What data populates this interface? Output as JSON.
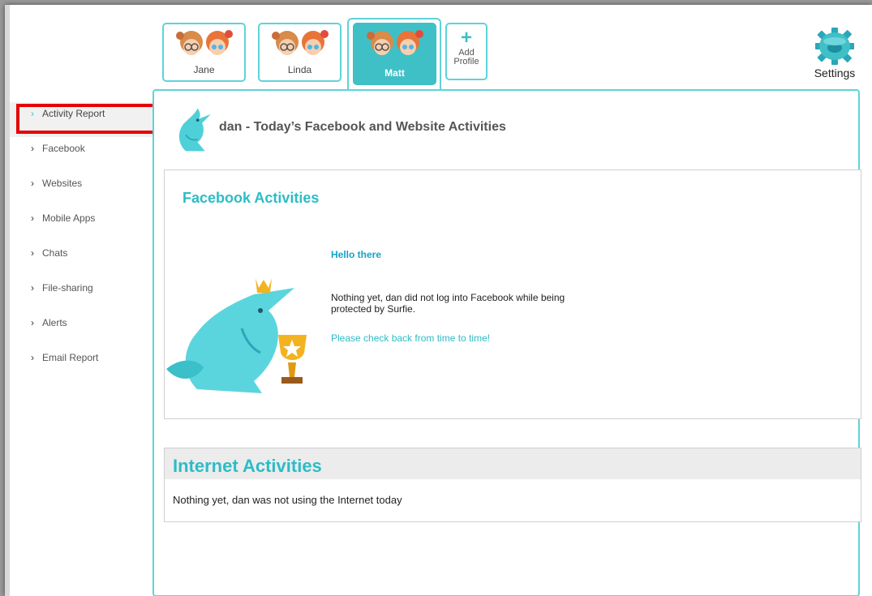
{
  "profiles": [
    {
      "name": "Jane",
      "active": false
    },
    {
      "name": "Linda",
      "active": false
    },
    {
      "name": "Matt",
      "active": true
    }
  ],
  "add_profile": {
    "label": "Add\nProfile",
    "label_line1": "Add",
    "label_line2": "Profile"
  },
  "settings": {
    "label": "Settings"
  },
  "sidebar": {
    "items": [
      {
        "label": "Activity Report",
        "active": true
      },
      {
        "label": "Facebook",
        "active": false
      },
      {
        "label": "Websites",
        "active": false
      },
      {
        "label": "Mobile Apps",
        "active": false
      },
      {
        "label": "Chats",
        "active": false
      },
      {
        "label": "File-sharing",
        "active": false
      },
      {
        "label": "Alerts",
        "active": false
      },
      {
        "label": "Email Report",
        "active": false
      }
    ]
  },
  "main": {
    "title": "dan - Today’s Facebook and Website Activities",
    "facebook": {
      "title": "Facebook Activities",
      "greeting": "Hello there",
      "message": "Nothing yet, dan did not log into Facebook while being protected by Surfie.",
      "check_back": "Please check back from time to time!"
    },
    "internet": {
      "title": "Internet Activities",
      "message": "Nothing yet, dan was not using the Internet today"
    }
  },
  "colors": {
    "accent": "#3fc0c6",
    "highlight": "#e60000",
    "title_teal": "#2dbcc6"
  },
  "icons": [
    "kids-avatar-icon",
    "plus-icon",
    "gear-icon",
    "chevron-right-icon",
    "dolphin-icon",
    "dolphin-trophy-illustration"
  ]
}
